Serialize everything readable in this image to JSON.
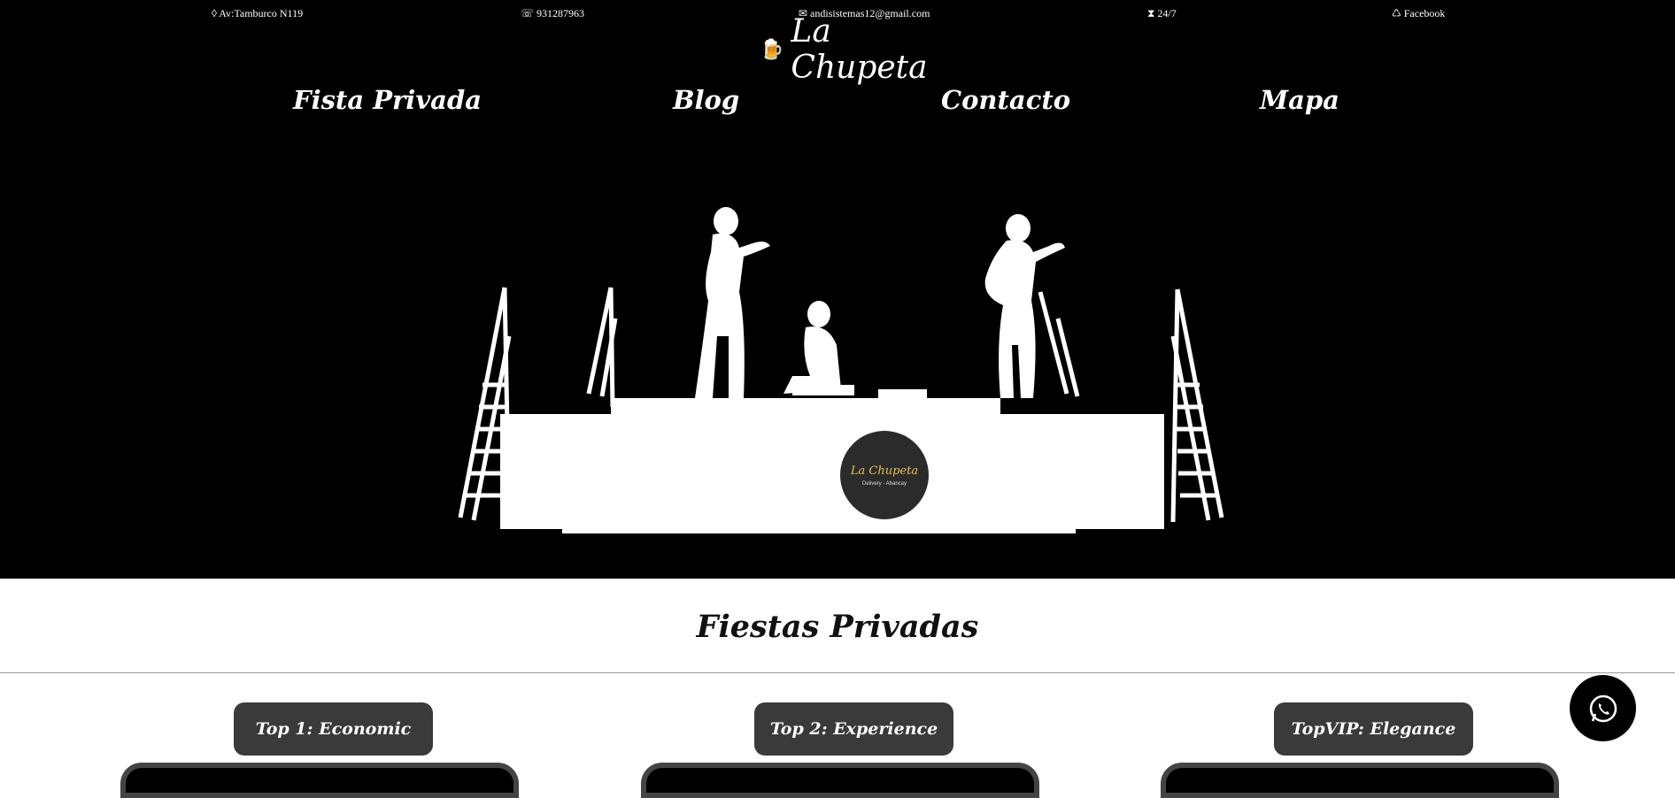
{
  "topbar": {
    "address": "◊ Av:Tamburco N119",
    "phone": "☏ 931287963",
    "email": "✉ andisistemas12@gmail.com",
    "hours": "⧗ 24/7",
    "social": "♺ Facebook"
  },
  "brand": {
    "icon": "beer-mug-icon",
    "name": "La Chupeta"
  },
  "nav": {
    "items": [
      "Fista Privada",
      "Blog",
      "Contacto",
      "Mapa"
    ]
  },
  "hero": {
    "logo_text": "La Chupeta",
    "logo_sub": "Delivery - Abancay"
  },
  "section": {
    "title": "Fiestas Privadas"
  },
  "plans": [
    {
      "label": "Top 1: Economic"
    },
    {
      "label": "Top 2: Experience"
    },
    {
      "label": "TopVIP: Elegance"
    }
  ],
  "floating": {
    "icon": "whatsapp-icon"
  },
  "colors": {
    "background_dark": "#000000",
    "button_gray": "#3a3a3a",
    "text_light": "#ffffff"
  }
}
